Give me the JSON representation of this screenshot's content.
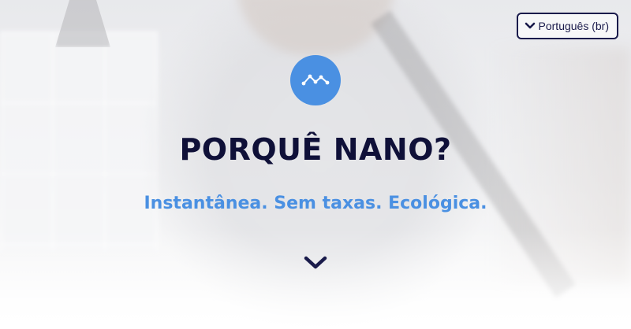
{
  "language_selector": {
    "label": "Português (br)",
    "icon": "chevron-down-icon"
  },
  "hero": {
    "logo_icon": "nano-logo-icon",
    "title": "PORQUÊ NANO?",
    "subtitle": "Instantânea. Sem taxas. Ecológica.",
    "scroll_icon": "chevron-down-icon"
  },
  "colors": {
    "accent": "#4a90e2",
    "title": "#0f1038",
    "navy": "#1a1b4b"
  }
}
